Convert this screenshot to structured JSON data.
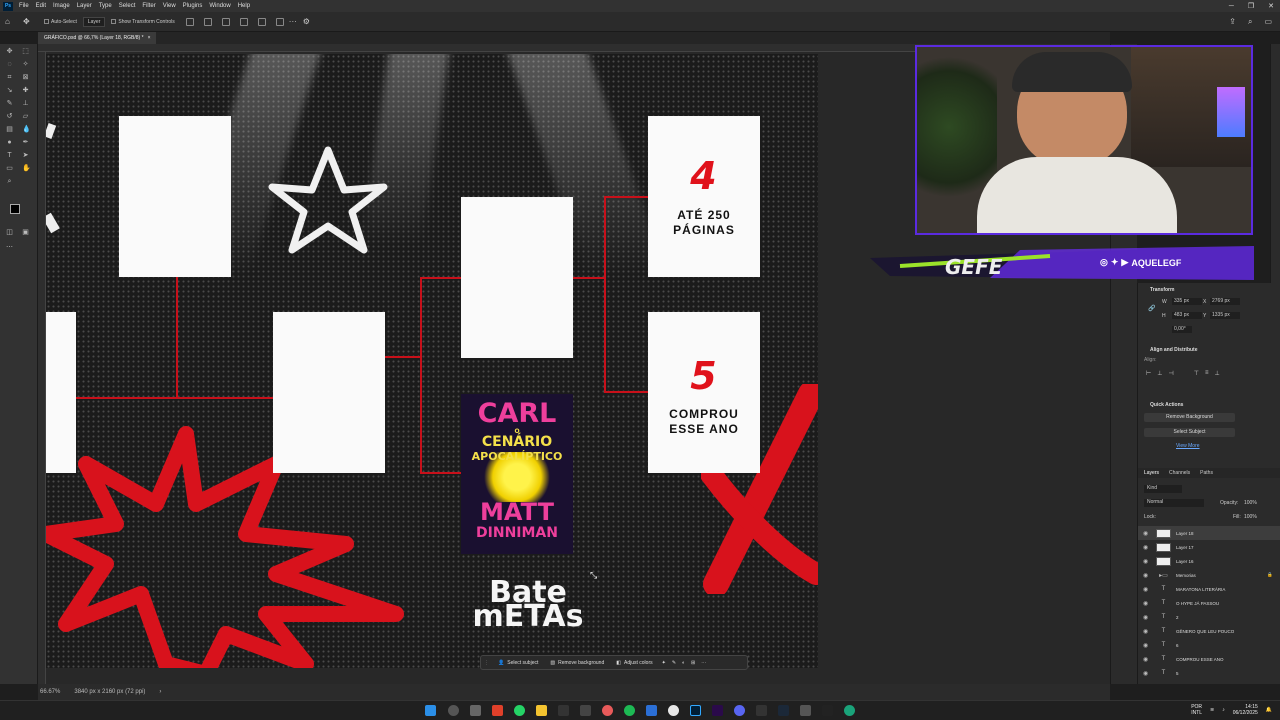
{
  "app": {
    "menu": [
      "File",
      "Edit",
      "Image",
      "Layer",
      "Type",
      "Select",
      "Filter",
      "View",
      "Plugins",
      "Window",
      "Help"
    ],
    "logo": "Ps"
  },
  "options_bar": {
    "auto_select_label": "Auto-Select",
    "auto_select_value": "Layer",
    "transform_controls_label": "Show Transform Controls"
  },
  "document": {
    "tab_title": "GRÁFICO.psd @ 66,7% (Layer 18, RGB/8) *",
    "tab_close": "×"
  },
  "canvas": {
    "card_4": {
      "number": "4",
      "line1": "ATÉ 250",
      "line2": "PÁGINAS"
    },
    "card_5": {
      "number": "5",
      "line1": "COMPROU",
      "line2": "ESSE ANO"
    },
    "book": {
      "line1": "CARL",
      "line2": "O",
      "line3": "CENÁRIO",
      "line4": "APOCALÍPTICO",
      "line5": "MATT",
      "line6": "DINNIMAN"
    },
    "headline": {
      "line1": "Bate",
      "line2": "mETAs"
    }
  },
  "context_bar": {
    "select_subject": "Select subject",
    "remove_background": "Remove background",
    "adjust_colors": "Adjust colors"
  },
  "status": {
    "zoom": "66.67%",
    "doc_size": "3840 px x 2160 px (72 ppi)"
  },
  "webcam_overlay": {
    "handle": "AQUELEGF"
  },
  "properties": {
    "transform_title": "Transform",
    "w_label": "W",
    "w_value": "335 px",
    "x_label": "X",
    "x_value": "2769 px",
    "h_label": "H",
    "h_value": "483 px",
    "y_label": "Y",
    "y_value": "1335 px",
    "angle_value": "0,00°",
    "align_title": "Align and Distribute",
    "align_to": "Align:",
    "quick_actions_title": "Quick Actions",
    "remove_bg_btn": "Remove Background",
    "select_subject_btn": "Select Subject",
    "view_more": "View More"
  },
  "layers_panel": {
    "tabs": [
      "Layers",
      "Channels",
      "Paths"
    ],
    "kind": "Kind",
    "blend_mode": "Normal",
    "opacity_label": "Opacity:",
    "opacity_value": "100%",
    "lock_label": "Lock:",
    "fill_label": "Fill:",
    "fill_value": "100%",
    "layers": [
      {
        "name": "Layer 18",
        "type": "pixel"
      },
      {
        "name": "Layer 17",
        "type": "pixel"
      },
      {
        "name": "Layer 16",
        "type": "pixel"
      },
      {
        "name": "Memorias",
        "type": "group"
      },
      {
        "name": "MARATONA LITERÁRIA",
        "type": "text"
      },
      {
        "name": "O HYPE JÁ PASSOU",
        "type": "text"
      },
      {
        "name": "2",
        "type": "text"
      },
      {
        "name": "GÊNERO QUE LEU POUCO",
        "type": "text"
      },
      {
        "name": "6",
        "type": "text"
      },
      {
        "name": "COMPROU ESSE ANO",
        "type": "text"
      },
      {
        "name": "5",
        "type": "text"
      }
    ]
  },
  "taskbar": {
    "lang1": "POR",
    "lang2": "INTL",
    "time": "14:15",
    "date": "06/12/2025"
  },
  "colors": {
    "accent_red": "#e0121b",
    "overlay_purple": "#6a2cf0",
    "overlay_green": "#9be22a"
  }
}
